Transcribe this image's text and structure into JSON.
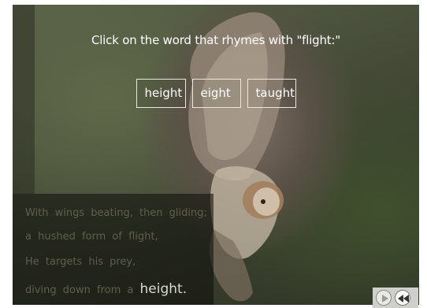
{
  "prompt": "Click on the word that rhymes with \"flight:\"",
  "choices": [
    {
      "label": "height"
    },
    {
      "label": "eight"
    },
    {
      "label": "taught"
    }
  ],
  "poem": {
    "line1": "With wings beating, then gliding;",
    "line2": "a hushed form of flight,",
    "line3": "He targets his prey,",
    "line4_prefix": "diving down from a",
    "line4_highlight": "height."
  },
  "controls": {
    "play_icon": "play-icon",
    "rewind_icon": "rewind-icon"
  },
  "colors": {
    "text": "#ffffff",
    "poem_dim": "#5f5f4a",
    "poem_highlight": "#d9d9d2",
    "choice_border": "#e9e9e4"
  }
}
